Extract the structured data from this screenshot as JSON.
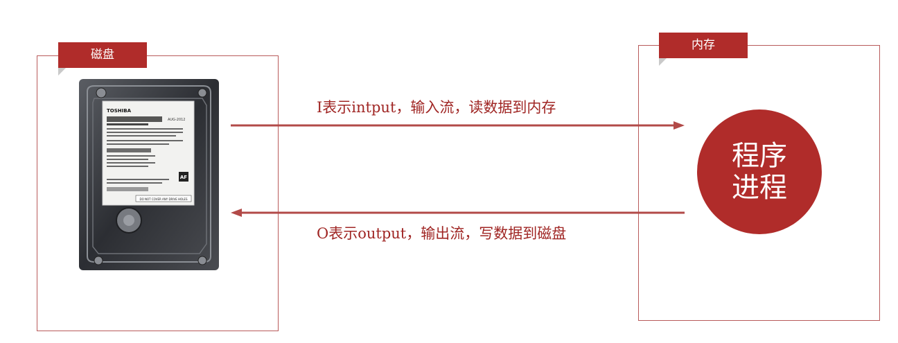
{
  "disk": {
    "label": "磁盘"
  },
  "memory": {
    "label": "内存"
  },
  "process": {
    "line1": "程序",
    "line2": "进程"
  },
  "flows": {
    "input": "I表示intput，输入流，读数据到内存",
    "output": "O表示output，输出流，写数据到磁盘"
  },
  "hdd_label": {
    "brand": "TOSHIBA",
    "date": "AUG-2012",
    "warning": "DO NOT COVER ANY DRIVE HOLES",
    "mark": "AF"
  },
  "colors": {
    "accent": "#b02c2a",
    "border": "#b85a5a",
    "arrow": "#b24a48"
  }
}
